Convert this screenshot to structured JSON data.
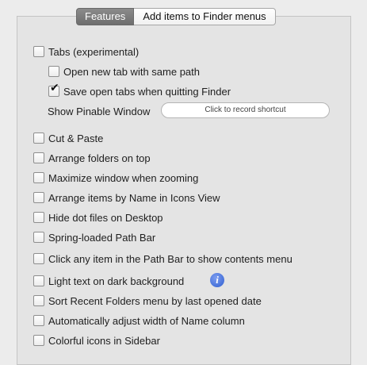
{
  "tabs": {
    "features": "Features",
    "finder_menus": "Add items to Finder menus"
  },
  "options": {
    "tabs_experimental": "Tabs (experimental)",
    "open_new_tab": "Open new tab with same path",
    "save_open_tabs": "Save open tabs when quitting Finder",
    "show_pinable_window": "Show Pinable Window",
    "shortcut_placeholder": "Click to record shortcut",
    "cut_paste": "Cut & Paste",
    "arrange_folders": "Arrange folders on top",
    "maximize_window": "Maximize window when zooming",
    "arrange_by_name": "Arrange items by Name in Icons View",
    "hide_dot_files": "Hide dot files on Desktop",
    "spring_loaded": "Spring-loaded Path Bar",
    "click_path_bar": "Click any item in the Path Bar to show contents menu",
    "light_text": "Light text on dark background",
    "sort_recent": "Sort Recent Folders menu by last opened date",
    "auto_adjust": "Automatically adjust width of Name column",
    "colorful_icons": "Colorful icons in Sidebar"
  },
  "checked": {
    "tabs_experimental": false,
    "open_new_tab": false,
    "save_open_tabs": true,
    "cut_paste": false,
    "arrange_folders": false,
    "maximize_window": false,
    "arrange_by_name": false,
    "hide_dot_files": false,
    "spring_loaded": false,
    "click_path_bar": false,
    "light_text": false,
    "sort_recent": false,
    "auto_adjust": false,
    "colorful_icons": false
  },
  "check_glyph": "✔",
  "info_icon": {
    "name": "info-icon",
    "glyph": "i"
  }
}
